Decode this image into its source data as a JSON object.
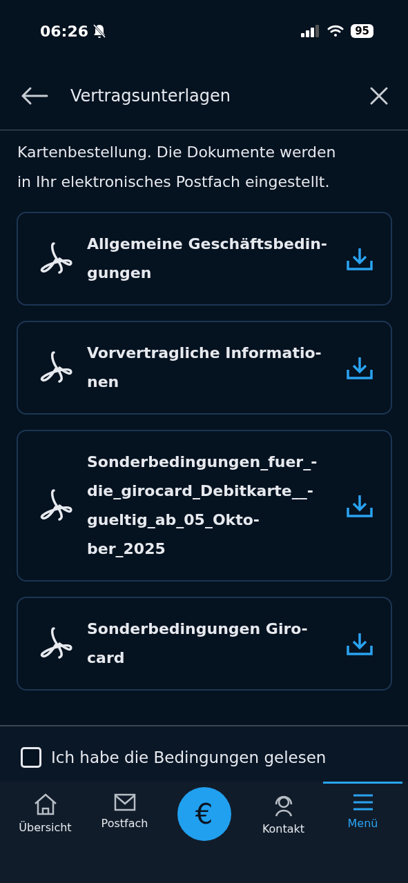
{
  "status_bar": {
    "time": "06:26",
    "battery": "95"
  },
  "header": {
    "title": "Vertragsunterlagen"
  },
  "intro": [
    "Kartenbestellung. Die Dokumente werden",
    "in Ihr elektronisches Postfach eingestellt."
  ],
  "documents": [
    {
      "title_lines": [
        "Allgemeine Geschäftsbedin-",
        "gungen"
      ]
    },
    {
      "title_lines": [
        "Vorvertragliche Informatio-",
        "nen"
      ]
    },
    {
      "title_lines": [
        "Sonderbedingungen_fuer_-",
        "die_girocard_Debitkarte__-",
        "gueltig_ab_05_Okto-",
        "ber_2025"
      ]
    },
    {
      "title_lines": [
        "Sonderbedingungen Giro-",
        "card"
      ]
    }
  ],
  "confirmation": {
    "label": "Ich habe die Bedingungen gelesen",
    "checked": false
  },
  "bottom_nav": [
    {
      "kind": "home",
      "label": "Übersicht",
      "selected": false
    },
    {
      "kind": "mail",
      "label": "Postfach",
      "selected": false
    },
    {
      "kind": "euro",
      "label": "€",
      "selected": false
    },
    {
      "kind": "contact",
      "label": "Kontakt",
      "selected": false
    },
    {
      "kind": "menu",
      "label": "Menü",
      "selected": true
    }
  ]
}
